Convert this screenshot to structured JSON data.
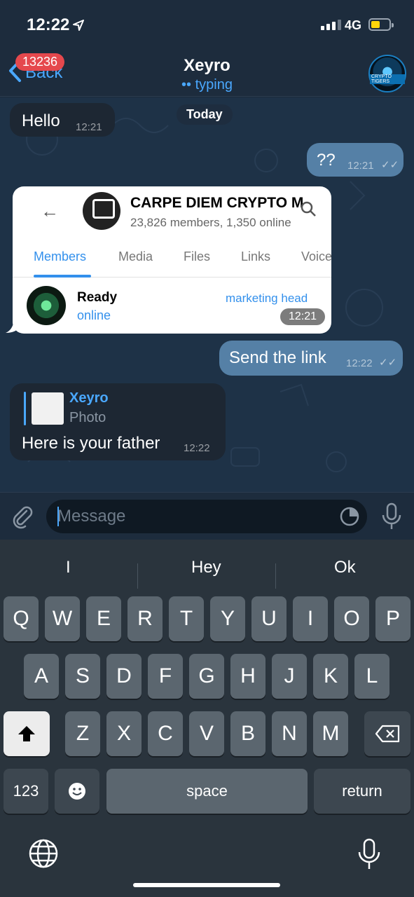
{
  "status_bar": {
    "time": "12:22",
    "network": "4G"
  },
  "header": {
    "back_label": "Back",
    "unread_count": "13236",
    "chat_title": "Xeyro",
    "chat_status": "typing",
    "avatar_caption": "CRYPTO TIGERS"
  },
  "chat": {
    "date_label": "Today",
    "messages": [
      {
        "dir": "in",
        "text": "Hello",
        "time": "12:21"
      },
      {
        "dir": "out",
        "text": "??",
        "time": "12:21"
      },
      {
        "dir": "out",
        "text": "Send the link",
        "time": "12:22"
      },
      {
        "dir": "in",
        "text": "Here is your father",
        "time": "12:22",
        "reply_name": "Xeyro",
        "reply_type": "Photo"
      }
    ],
    "photo": {
      "group_name": "CARPE DIEM CRYPTO MA",
      "group_sub": "23,826 members, 1,350 online",
      "tabs": [
        "Members",
        "Media",
        "Files",
        "Links",
        "Voice"
      ],
      "member_name": "Ready",
      "member_status": "online",
      "member_role": "marketing head",
      "time": "12:21"
    }
  },
  "input": {
    "placeholder": "Message"
  },
  "keyboard": {
    "suggestions": [
      "I",
      "Hey",
      "Ok"
    ],
    "row1": [
      "Q",
      "W",
      "E",
      "R",
      "T",
      "Y",
      "U",
      "I",
      "O",
      "P"
    ],
    "row2": [
      "A",
      "S",
      "D",
      "F",
      "G",
      "H",
      "J",
      "K",
      "L"
    ],
    "row3": [
      "Z",
      "X",
      "C",
      "V",
      "B",
      "N",
      "M"
    ],
    "numbers_label": "123",
    "space_label": "space",
    "return_label": "return"
  }
}
